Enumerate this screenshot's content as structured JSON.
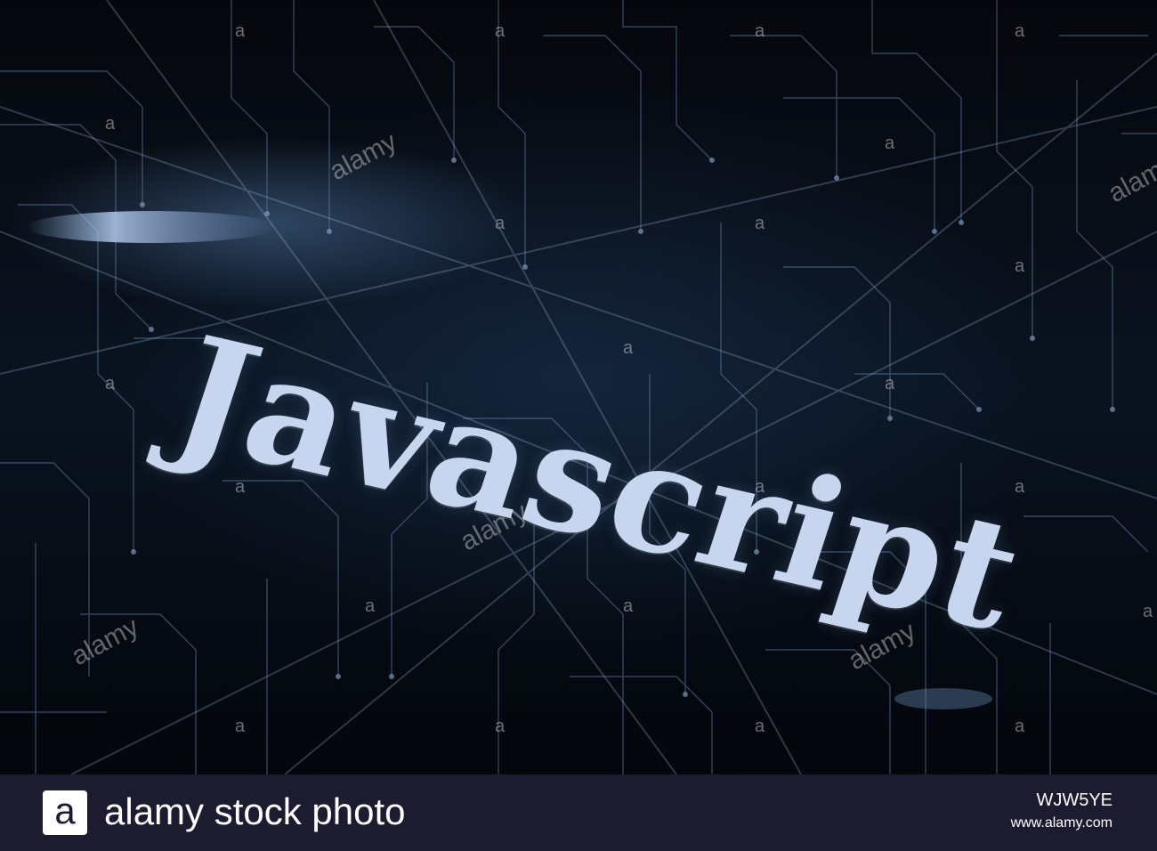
{
  "image": {
    "headline": "Javascript",
    "watermark": {
      "word": "alamy",
      "letter": "a"
    }
  },
  "footer": {
    "logo_letter": "a",
    "brand": "alamy stock photo",
    "image_id": "WJW5YE",
    "url": "www.alamy.com"
  },
  "colors": {
    "background": "#05080d",
    "circuit": "#6f8fb5",
    "headline": "#c7d6ee",
    "footer": "#1d1b2f"
  }
}
